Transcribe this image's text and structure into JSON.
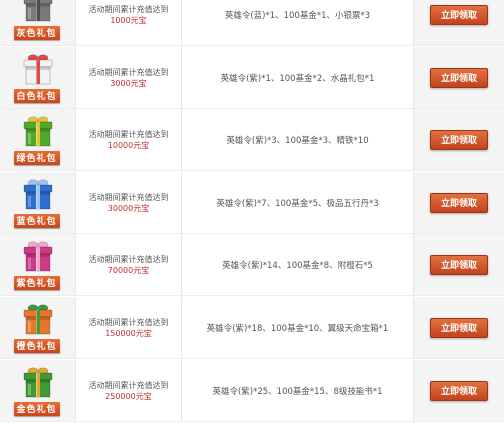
{
  "rows": [
    {
      "gift_label": "灰色礼包",
      "color": "#7a7a7a",
      "ribbon": "#4e4e4e",
      "cond_text": "活动期间累计充值达到",
      "amount": "1000元宝",
      "reward": "英雄令(蓝)*1、100基金*1、小银票*3",
      "button": "立即领取"
    },
    {
      "gift_label": "白色礼包",
      "color": "#f2f2f2",
      "ribbon": "#e04a4a",
      "cond_text": "活动期间累计充值达到",
      "amount": "3000元宝",
      "reward": "英雄令(紫)*1、100基金*2、水晶礼包*1",
      "button": "立即领取"
    },
    {
      "gift_label": "绿色礼包",
      "color": "#4faa2c",
      "ribbon": "#e9c23a",
      "cond_text": "活动期间累计充值达到",
      "amount": "10000元宝",
      "reward": "英雄令(紫)*3、100基金*3、精铁*10",
      "button": "立即领取"
    },
    {
      "gift_label": "蓝色礼包",
      "color": "#2f6fd0",
      "ribbon": "#9fc4f2",
      "cond_text": "活动期间累计充值达到",
      "amount": "30000元宝",
      "reward": "英雄令(紫)*7、100基金*5、极品五行丹*3",
      "button": "立即领取"
    },
    {
      "gift_label": "紫色礼包",
      "color": "#cc3a8a",
      "ribbon": "#f3a6cc",
      "cond_text": "活动期间累计充值达到",
      "amount": "70000元宝",
      "reward": "英雄令(紫)*14、100基金*8、附橙石*5",
      "button": "立即领取"
    },
    {
      "gift_label": "橙色礼包",
      "color": "#e8762a",
      "ribbon": "#3e9a3a",
      "cond_text": "活动期间累计充值达到",
      "amount": "150000元宝",
      "reward": "英雄令(紫)*18、100基金*10、翼级天命宝箱*1",
      "button": "立即领取"
    },
    {
      "gift_label": "金色礼包",
      "color": "#3f9a36",
      "ribbon": "#e0a830",
      "cond_text": "活动期间累计充值达到",
      "amount": "250000元宝",
      "reward": "英雄令(紫)*25、100基金*15、8级技能书*1",
      "button": "立即领取"
    }
  ]
}
